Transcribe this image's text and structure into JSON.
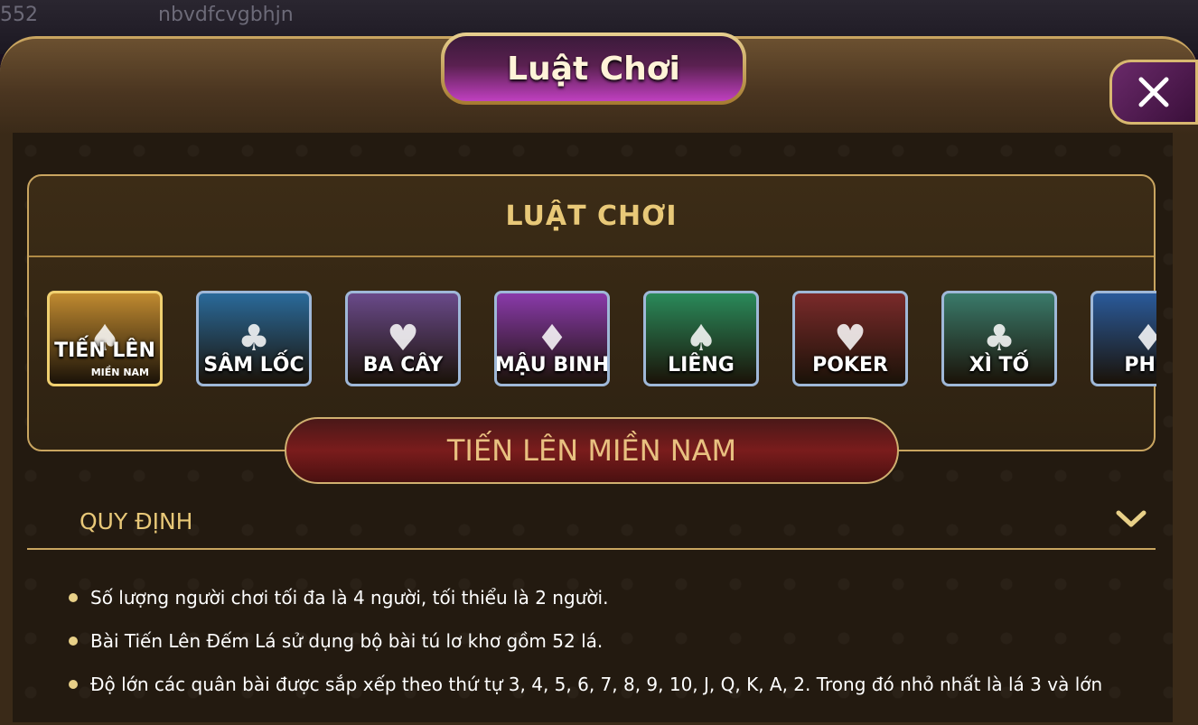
{
  "background": {
    "top_left_text": "552",
    "top_center_text": "nbvdfcvgbhjn"
  },
  "dialog": {
    "title": "Luật Chơi",
    "close_icon": "close-icon"
  },
  "panel": {
    "title": "LUẬT CHƠI",
    "games": [
      {
        "label": "TIẾN LÊN",
        "sub": "MIỀN NAM",
        "selected": true,
        "color": "#c08a30"
      },
      {
        "label": "SÂM LỐC",
        "sub": "",
        "selected": false,
        "color": "#2a6a9a"
      },
      {
        "label": "BA CÂY",
        "sub": "",
        "selected": false,
        "color": "#6a4a8a"
      },
      {
        "label": "MẬU BINH",
        "sub": "",
        "selected": false,
        "color": "#8a3aaa"
      },
      {
        "label": "LIÊNG",
        "sub": "",
        "selected": false,
        "color": "#2a8a5a"
      },
      {
        "label": "POKER",
        "sub": "",
        "selected": false,
        "color": "#7a2a2a"
      },
      {
        "label": "XÌ TỐ",
        "sub": "",
        "selected": false,
        "color": "#3a7a6a"
      },
      {
        "label": "PHỎ",
        "sub": "",
        "selected": false,
        "color": "#2a5a9a"
      }
    ]
  },
  "selected_game": "TIẾN LÊN MIỀN NAM",
  "section": {
    "title": "QUY ĐỊNH",
    "chevron_icon": "chevron-down-icon"
  },
  "rules": [
    "Số lượng người chơi tối đa là 4 người, tối thiểu là 2 người.",
    "Bài Tiến Lên Đếm Lá sử dụng bộ bài tú lơ khơ gồm 52 lá.",
    "Độ lớn các quân bài được sắp xếp theo thứ tự 3, 4, 5, 6, 7, 8, 9, 10, J, Q, K, A, 2. Trong đó nhỏ nhất là lá 3 và lớn"
  ]
}
